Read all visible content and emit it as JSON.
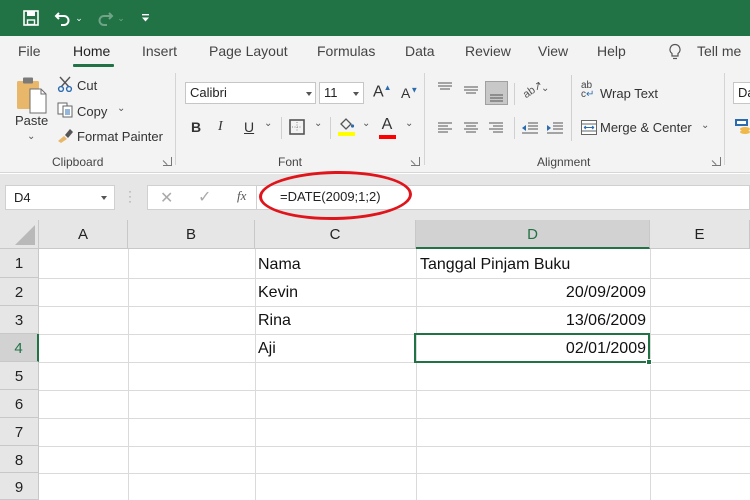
{
  "quick_access": {
    "save_icon": "save-icon",
    "undo_icon": "undo-icon",
    "redo_icon": "redo-icon",
    "customize_icon": "customize-qat-icon"
  },
  "colors": {
    "brand_green": "#217346",
    "annotation_red": "#e0141b",
    "highlight_yellow": "#ffff00",
    "font_color_red": "#ff0000"
  },
  "tabs": [
    {
      "label": "File"
    },
    {
      "label": "Home",
      "active": true
    },
    {
      "label": "Insert"
    },
    {
      "label": "Page Layout"
    },
    {
      "label": "Formulas"
    },
    {
      "label": "Data"
    },
    {
      "label": "Review"
    },
    {
      "label": "View"
    },
    {
      "label": "Help"
    }
  ],
  "tell_me": {
    "label": "Tell me",
    "icon": "lightbulb-icon"
  },
  "ribbon": {
    "clipboard": {
      "group_label": "Clipboard",
      "paste": "Paste",
      "cut": "Cut",
      "copy": "Copy",
      "format_painter": "Format Painter"
    },
    "font": {
      "group_label": "Font",
      "font_name": "Calibri",
      "font_size": "11",
      "bold": "B",
      "italic": "I",
      "underline": "U",
      "font_color_glyph": "A"
    },
    "alignment": {
      "group_label": "Alignment",
      "wrap_text": "Wrap Text",
      "merge_center": "Merge & Center"
    },
    "number": {
      "format_value": "Da"
    }
  },
  "formula_bar": {
    "name_box": "D4",
    "fx_label": "fx",
    "formula": "=DATE(2009;1;2)"
  },
  "sheet": {
    "columns": [
      "A",
      "B",
      "C",
      "D",
      "E"
    ],
    "selected_column": "D",
    "rows": [
      "1",
      "2",
      "3",
      "4",
      "5",
      "6",
      "7",
      "8",
      "9"
    ],
    "selected_row": "4",
    "active_cell": "D4",
    "cells": {
      "C1": "Nama",
      "D1": "Tanggal Pinjam Buku",
      "C2": "Kevin",
      "D2": "20/09/2009",
      "C3": "Rina",
      "D3": "13/06/2009",
      "C4": "Aji",
      "D4": "02/01/2009"
    }
  }
}
